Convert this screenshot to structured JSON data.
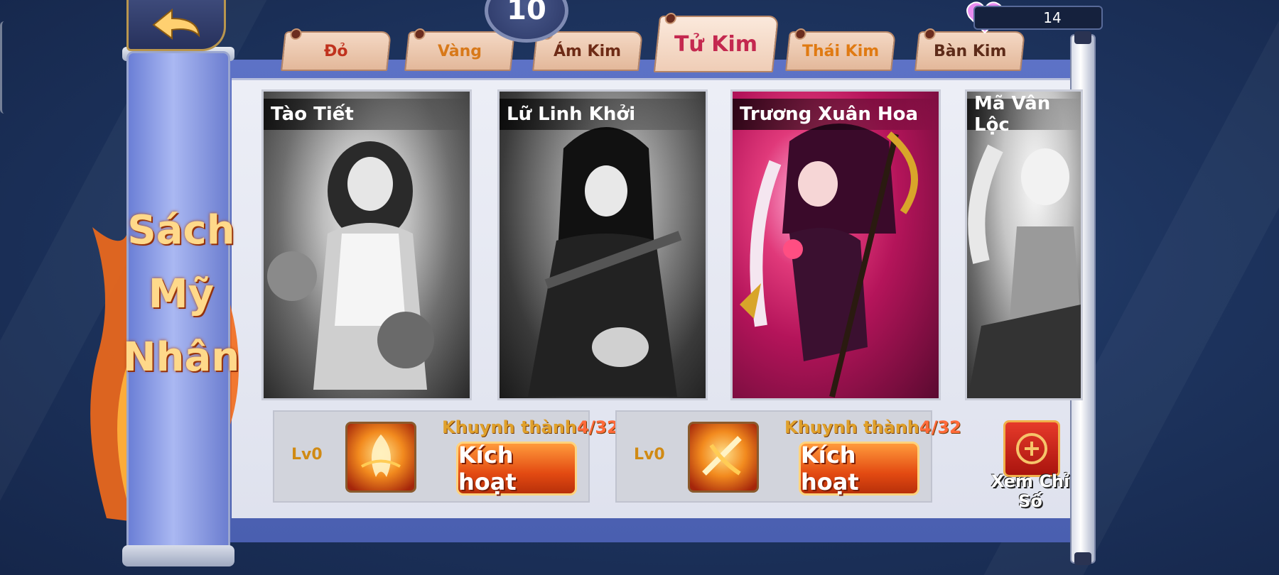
{
  "header": {
    "back_icon": "back-arrow-icon",
    "level": "10",
    "currency": {
      "icon": "heart-icon",
      "value": "14"
    }
  },
  "book": {
    "title_lines": [
      "Sách",
      "Mỹ",
      "Nhân"
    ]
  },
  "tabs": [
    {
      "label": "Đỏ",
      "color": "#c0321e",
      "active": false
    },
    {
      "label": "Vàng",
      "color": "#d8791a",
      "active": false
    },
    {
      "label": "Ám Kim",
      "color": "#6e2b16",
      "active": false
    },
    {
      "label": "Tử Kim",
      "color": "#c4284f",
      "active": true
    },
    {
      "label": "Thái Kim",
      "color": "#e07a12",
      "active": false
    },
    {
      "label": "Bàn Kim",
      "color": "#5e2b19",
      "active": false
    }
  ],
  "cards": [
    {
      "name": "Tào Tiết",
      "style": "grayscale"
    },
    {
      "name": "Lữ Linh Khởi",
      "style": "grayscale"
    },
    {
      "name": "Trương Xuân Hoa",
      "style": "color"
    },
    {
      "name": "Mã Vân Lộc",
      "style": "grayscale"
    }
  ],
  "pairs": [
    {
      "level": "Lv0",
      "label": "Khuynh thành",
      "progress": "4/32",
      "button": "Kích hoạt"
    },
    {
      "level": "Lv0",
      "label": "Khuynh thành",
      "progress": "4/32",
      "button": "Kích hoạt"
    }
  ],
  "stats": {
    "label": "Xem Chỉ Số",
    "icon": "scroll-icon"
  }
}
